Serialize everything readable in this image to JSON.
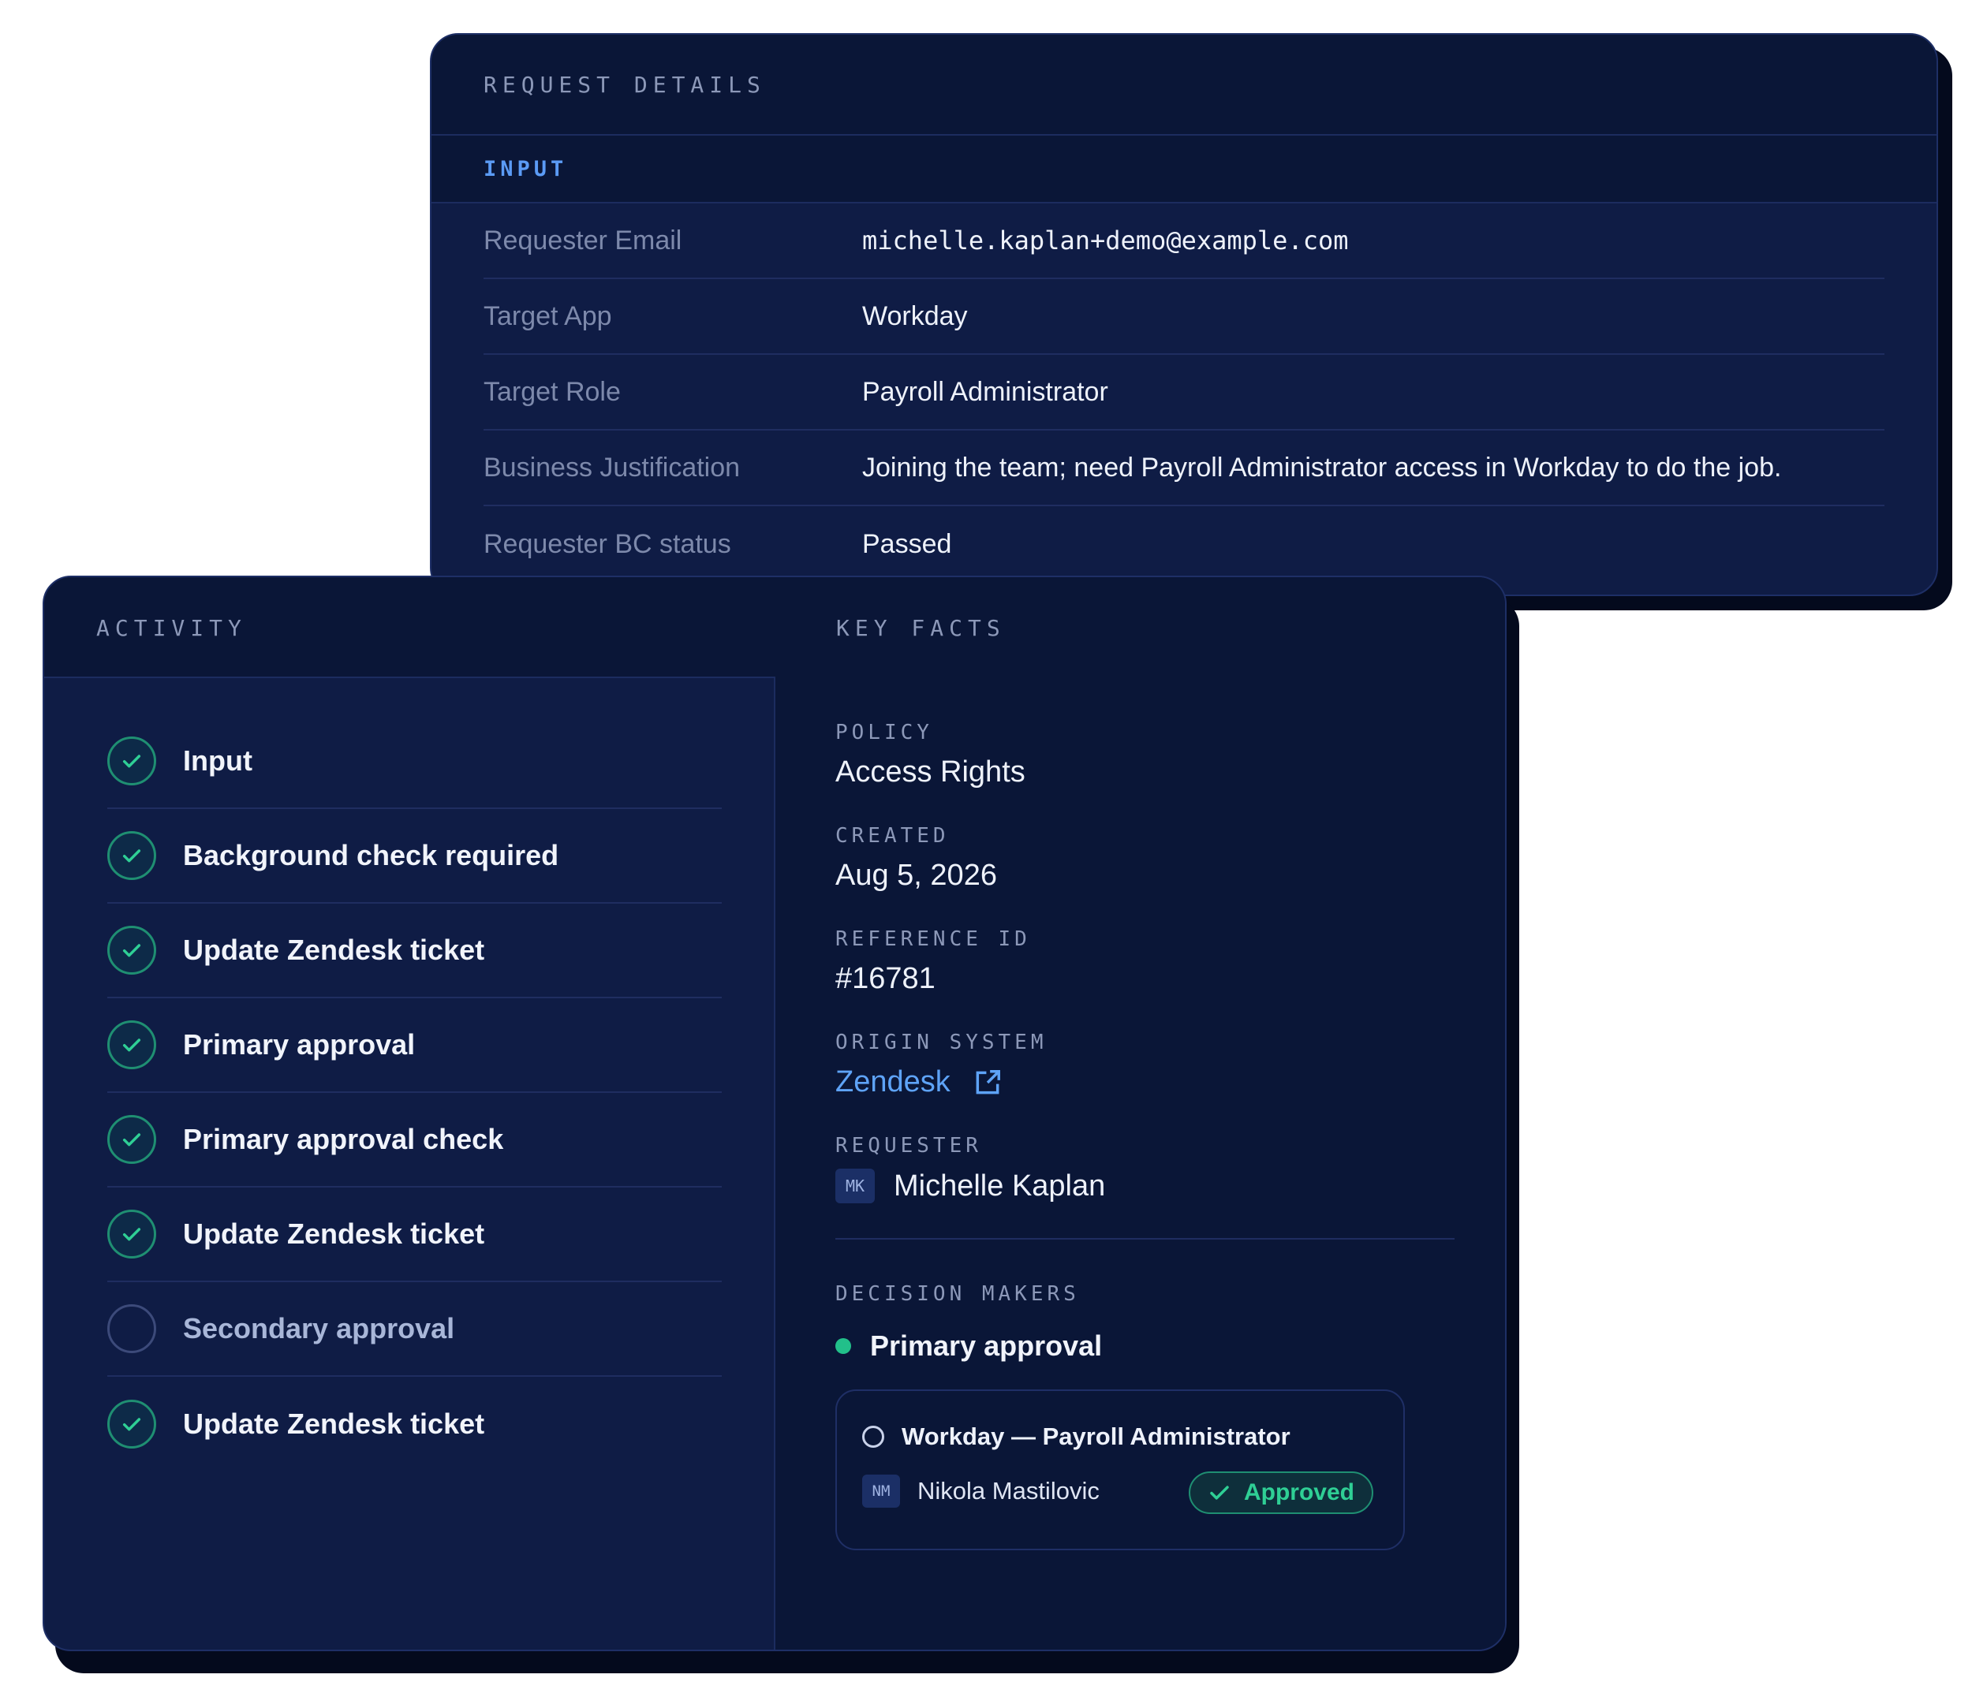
{
  "request_details": {
    "title": "REQUEST DETAILS",
    "section": "INPUT",
    "rows": [
      {
        "key": "Requester Email",
        "value": "michelle.kaplan+demo@example.com"
      },
      {
        "key": "Target App",
        "value": "Workday"
      },
      {
        "key": "Target Role",
        "value": "Payroll Administrator"
      },
      {
        "key": "Business Justification",
        "value": "Joining the team; need Payroll Administrator access in Workday to do the job."
      },
      {
        "key": "Requester BC status",
        "value": "Passed"
      }
    ]
  },
  "activity": {
    "title": "ACTIVITY",
    "items": [
      {
        "label": "Input",
        "status": "done"
      },
      {
        "label": "Background check required",
        "status": "done"
      },
      {
        "label": "Update Zendesk ticket",
        "status": "done"
      },
      {
        "label": "Primary approval",
        "status": "done"
      },
      {
        "label": "Primary approval check",
        "status": "done"
      },
      {
        "label": "Update Zendesk ticket",
        "status": "done"
      },
      {
        "label": "Secondary approval",
        "status": "pending"
      },
      {
        "label": "Update Zendesk ticket",
        "status": "done"
      }
    ]
  },
  "key_facts": {
    "title": "KEY FACTS",
    "policy_label": "POLICY",
    "policy": "Access Rights",
    "created_label": "CREATED",
    "created": "Aug 5, 2026",
    "reference_label": "REFERENCE ID",
    "reference": "#16781",
    "origin_label": "ORIGIN SYSTEM",
    "origin": "Zendesk",
    "origin_icon": "external-link-icon",
    "requester_label": "REQUESTER",
    "requester_initials": "MK",
    "requester": "Michelle Kaplan",
    "decision_makers_label": "DECISION MAKERS",
    "decision": {
      "title": "Primary approval",
      "item": "Workday — Payroll Administrator",
      "approver_initials": "NM",
      "approver": "Nikola Mastilovic",
      "status": "Approved"
    }
  },
  "colors": {
    "card_bg": "#0f1c45",
    "header_bg": "#0a1637",
    "accent_blue": "#5b9bf5",
    "success_green": "#2fcf95"
  }
}
